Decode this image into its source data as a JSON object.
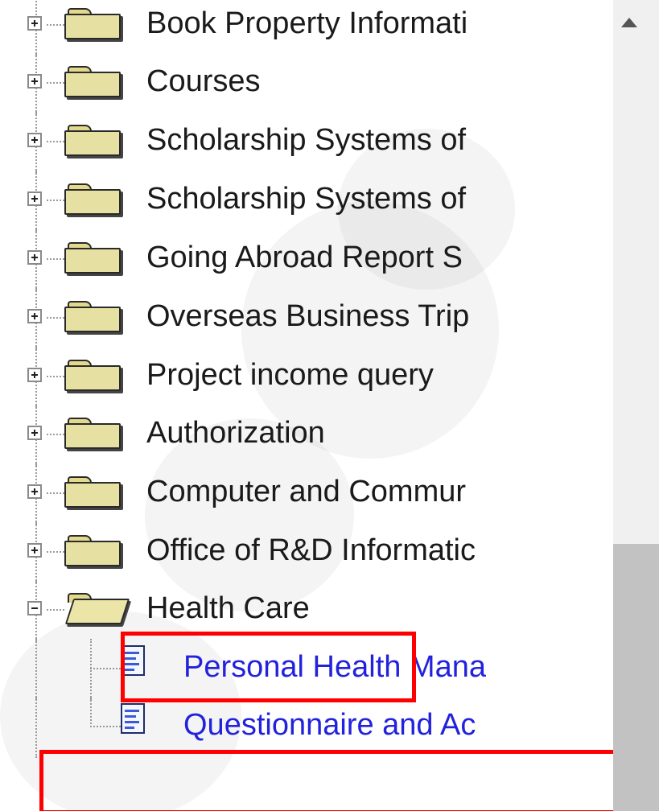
{
  "tree": {
    "items": [
      {
        "label": "Book Property Informati",
        "type": "folder",
        "expanded": false
      },
      {
        "label": "Courses",
        "type": "folder",
        "expanded": false
      },
      {
        "label": "Scholarship Systems of",
        "type": "folder",
        "expanded": false
      },
      {
        "label": "Scholarship Systems of",
        "type": "folder",
        "expanded": false
      },
      {
        "label": "Going Abroad Report S",
        "type": "folder",
        "expanded": false
      },
      {
        "label": "Overseas Business Trip",
        "type": "folder",
        "expanded": false
      },
      {
        "label": "Project income query",
        "type": "folder",
        "expanded": false
      },
      {
        "label": "Authorization",
        "type": "folder",
        "expanded": false
      },
      {
        "label": "Computer and Commur",
        "type": "folder",
        "expanded": false
      },
      {
        "label": "Office of R&D Informatic",
        "type": "folder",
        "expanded": false
      },
      {
        "label": "Health Care",
        "type": "folder",
        "expanded": true,
        "highlighted": true
      },
      {
        "label": "Personal Health Mana",
        "type": "document",
        "link": true
      },
      {
        "label": "Questionnaire and Ac",
        "type": "document",
        "link": true,
        "highlighted": true
      }
    ]
  },
  "icons": {
    "expander_collapsed": "plus-box-icon",
    "expander_expanded": "minus-box-icon",
    "folder": "folder-icon",
    "document": "document-icon",
    "scroll_up": "scroll-up-arrow-icon"
  },
  "colors": {
    "link": "#2222dd",
    "text": "#1a1a1a",
    "highlight_border": "#ff0000",
    "scrollbar_track": "#f0f0f0",
    "scrollbar_thumb": "#c2c2c2"
  }
}
